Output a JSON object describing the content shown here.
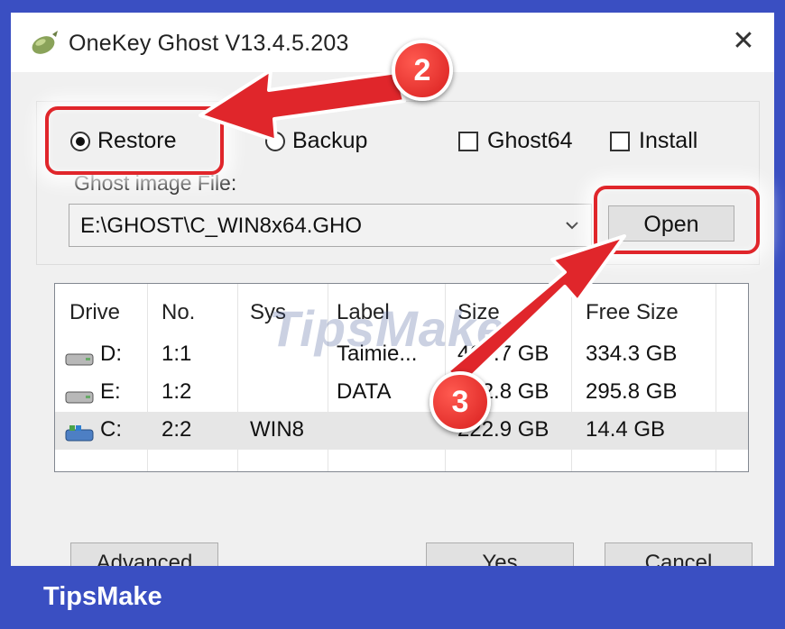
{
  "window": {
    "title": "OneKey Ghost V13.4.5.203",
    "close_glyph": "✕"
  },
  "mode": {
    "restore_label": "Restore",
    "backup_label": "Backup",
    "selected": "Restore"
  },
  "options": {
    "ghost64_label": "Ghost64",
    "install_label": "Install"
  },
  "image_file": {
    "label": "Ghost image File:",
    "value": "E:\\GHOST\\C_WIN8x64.GHO",
    "open_label": "Open"
  },
  "partitions": {
    "columns": [
      "Drive",
      "No.",
      "Sys",
      "Label",
      "Size",
      "Free Size"
    ],
    "rows": [
      {
        "drive": "D:",
        "no": "1:1",
        "sys": "",
        "label": "Taimie...",
        "size": "468.7 GB",
        "free": "334.3 GB",
        "icon": "hard-drive-icon"
      },
      {
        "drive": "E:",
        "no": "1:2",
        "sys": "",
        "label": "DATA",
        "size": "422.8 GB",
        "free": "295.8 GB",
        "icon": "hard-drive-icon"
      },
      {
        "drive": "C:",
        "no": "2:2",
        "sys": "WIN8",
        "label": "",
        "size": "222.9 GB",
        "free": "14.4 GB",
        "icon": "system-drive-icon"
      }
    ],
    "selected_row": 2
  },
  "buttons": {
    "advanced_label": "Advanced",
    "yes_label": "Yes",
    "cancel_label": "Cancel"
  },
  "annotations": {
    "step2": "2",
    "step3": "3",
    "color": "#e0262b"
  },
  "watermark": "TipsMake",
  "footer": {
    "brand": "TipsMake",
    "color": "#3a4fc2"
  }
}
